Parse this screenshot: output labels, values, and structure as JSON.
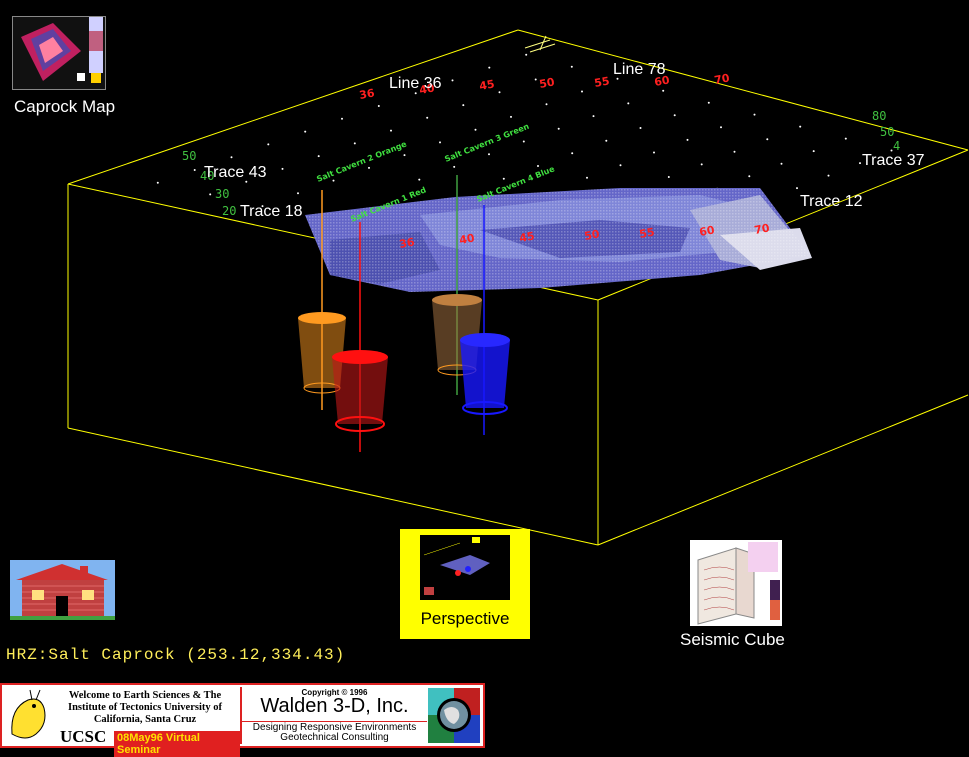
{
  "caprock": {
    "label": "Caprock Map"
  },
  "scene": {
    "line_labels": [
      "Line 36",
      "Line 78"
    ],
    "trace_labels": [
      "Trace 43",
      "Trace 18",
      "Trace 37",
      "Trace 12"
    ],
    "axis_numbers_left": [
      "50",
      "40",
      "30",
      "20"
    ],
    "axis_numbers_right": [
      "80",
      "50",
      "4"
    ],
    "well_labels": [
      "Salt Cavern 2 Orange",
      "Salt Cavern 1 Red",
      "Salt Cavern 3 Green",
      "Salt Cavern 4 Blue"
    ],
    "colors": {
      "box": "#ffff00",
      "orange": "#ff9a20",
      "red": "#ff1010",
      "green": "#40a040",
      "blue": "#1818ff"
    }
  },
  "status": {
    "text": "HRZ:Salt Caprock (253.12,334.43)"
  },
  "perspective": {
    "label": "Perspective"
  },
  "seismic": {
    "label": "Seismic Cube"
  },
  "banner": {
    "welcome": "Welcome to Earth Sciences & The Institute of Tectonics University of California, Santa Cruz",
    "ucsc": "UCSC",
    "seminar": "08May96 Virtual Seminar",
    "copyright": "Copyright © 1996",
    "company": "Walden 3-D, Inc.",
    "tagline1": "Designing Responsive Environments",
    "tagline2": "Geotechnical Consulting"
  }
}
